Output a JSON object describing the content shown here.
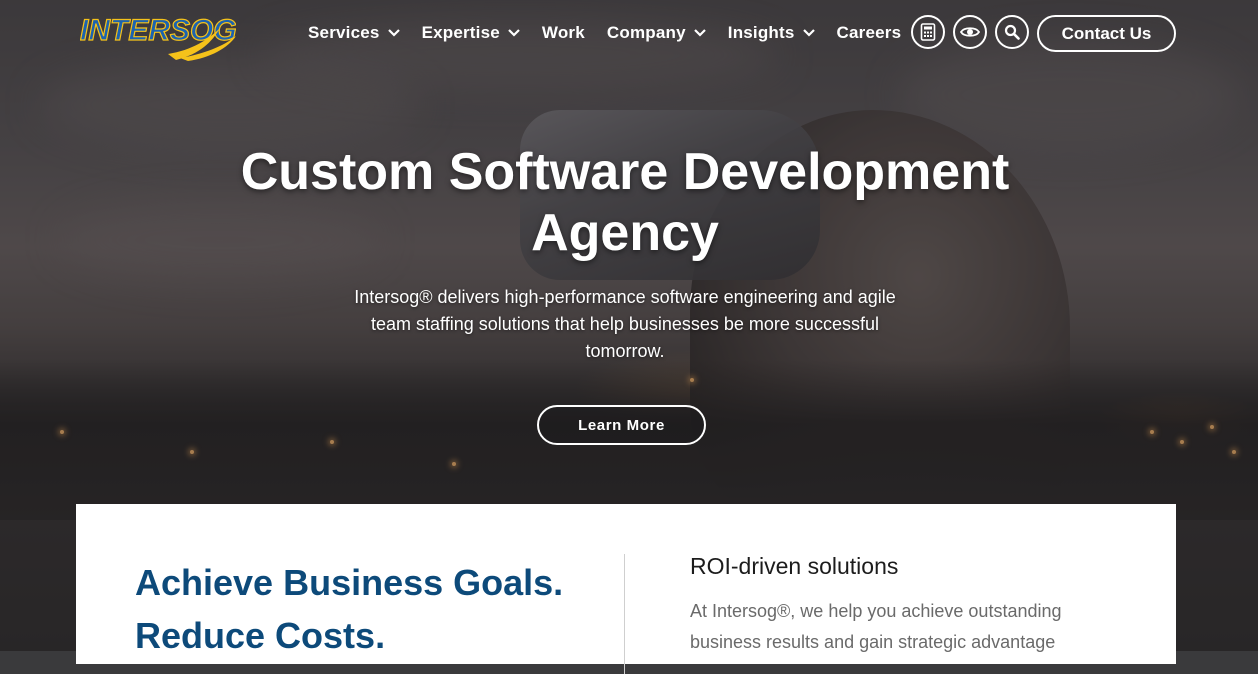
{
  "header": {
    "logo_text": "INTERSOG",
    "nav": [
      {
        "label": "Services",
        "has_dropdown": true
      },
      {
        "label": "Expertise",
        "has_dropdown": true
      },
      {
        "label": "Work",
        "has_dropdown": false
      },
      {
        "label": "Company",
        "has_dropdown": true
      },
      {
        "label": "Insights",
        "has_dropdown": true
      },
      {
        "label": "Careers",
        "has_dropdown": false
      }
    ],
    "icon_buttons": [
      "calculator-icon",
      "eye-icon",
      "search-icon"
    ],
    "contact_label": "Contact Us"
  },
  "hero": {
    "title_line1": "Custom Software Development",
    "title_line2": "Agency",
    "subtitle": "Intersog® delivers high-performance software engineering and agile team staffing solutions that help businesses be more successful tomorrow.",
    "cta_label": "Learn More"
  },
  "intro": {
    "headline_line1": "Achieve Business Goals.",
    "headline_line2": "Reduce Costs.",
    "roi_title": "ROI-driven solutions",
    "roi_text": "At Intersog®, we help you achieve outstanding business results and gain strategic advantage"
  },
  "colors": {
    "headline": "#0d4a7a",
    "logo_blue": "#1b63b0",
    "logo_yellow": "#f5c21a"
  }
}
